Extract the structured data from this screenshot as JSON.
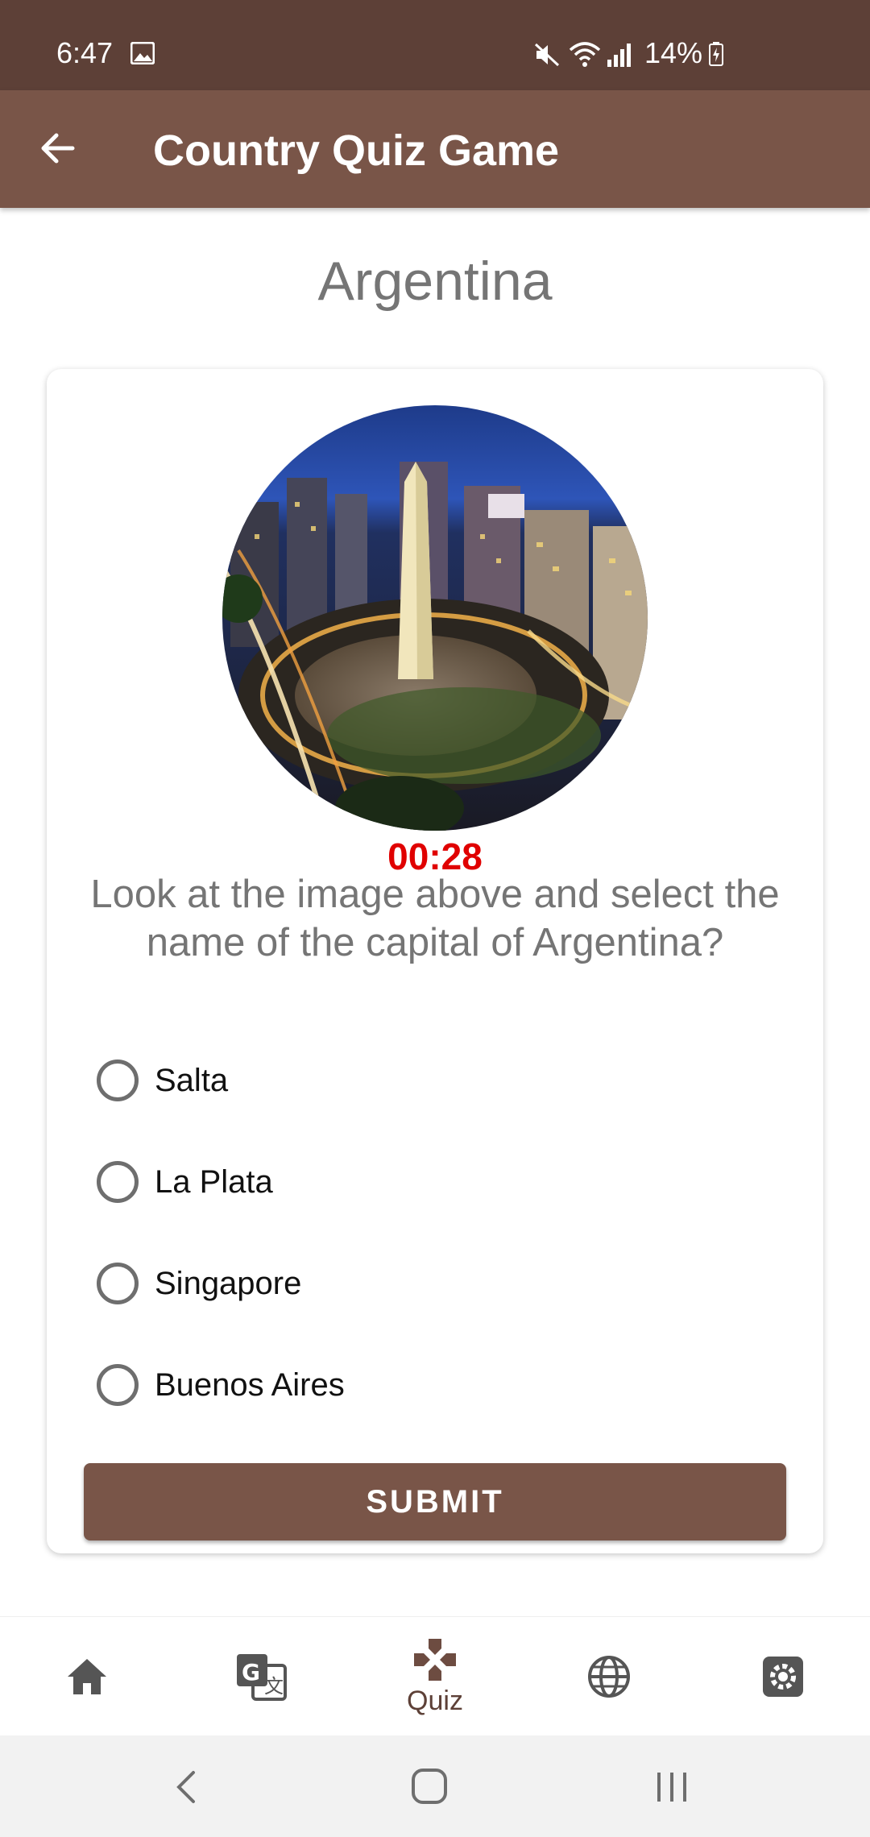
{
  "status_bar": {
    "time": "6:47",
    "battery": "14%",
    "icons": [
      "image-icon",
      "mute-icon",
      "wifi-icon",
      "signal-icon",
      "battery-charging-icon"
    ]
  },
  "app_bar": {
    "title": "Country Quiz Game",
    "back_icon": "arrow-back-icon"
  },
  "country": "Argentina",
  "quiz": {
    "image_alt": "Buenos Aires obelisk at night",
    "timer": "00:28",
    "question": "Look at the image above and select the name of the capital of Argentina?",
    "options": [
      {
        "label": "Salta",
        "selected": false
      },
      {
        "label": "La Plata",
        "selected": false
      },
      {
        "label": "Singapore",
        "selected": false
      },
      {
        "label": "Buenos Aires",
        "selected": false
      }
    ],
    "submit_label": "SUBMIT"
  },
  "bottom_nav": {
    "items": [
      {
        "icon": "home-icon",
        "label": ""
      },
      {
        "icon": "translate-icon",
        "label": ""
      },
      {
        "icon": "gamepad-icon",
        "label": "Quiz",
        "active": true
      },
      {
        "icon": "globe-icon",
        "label": ""
      },
      {
        "icon": "settings-icon",
        "label": ""
      }
    ]
  },
  "colors": {
    "status_bar": "#5d4037",
    "app_bar": "#795548",
    "accent": "#795548",
    "timer": "#e00000"
  }
}
